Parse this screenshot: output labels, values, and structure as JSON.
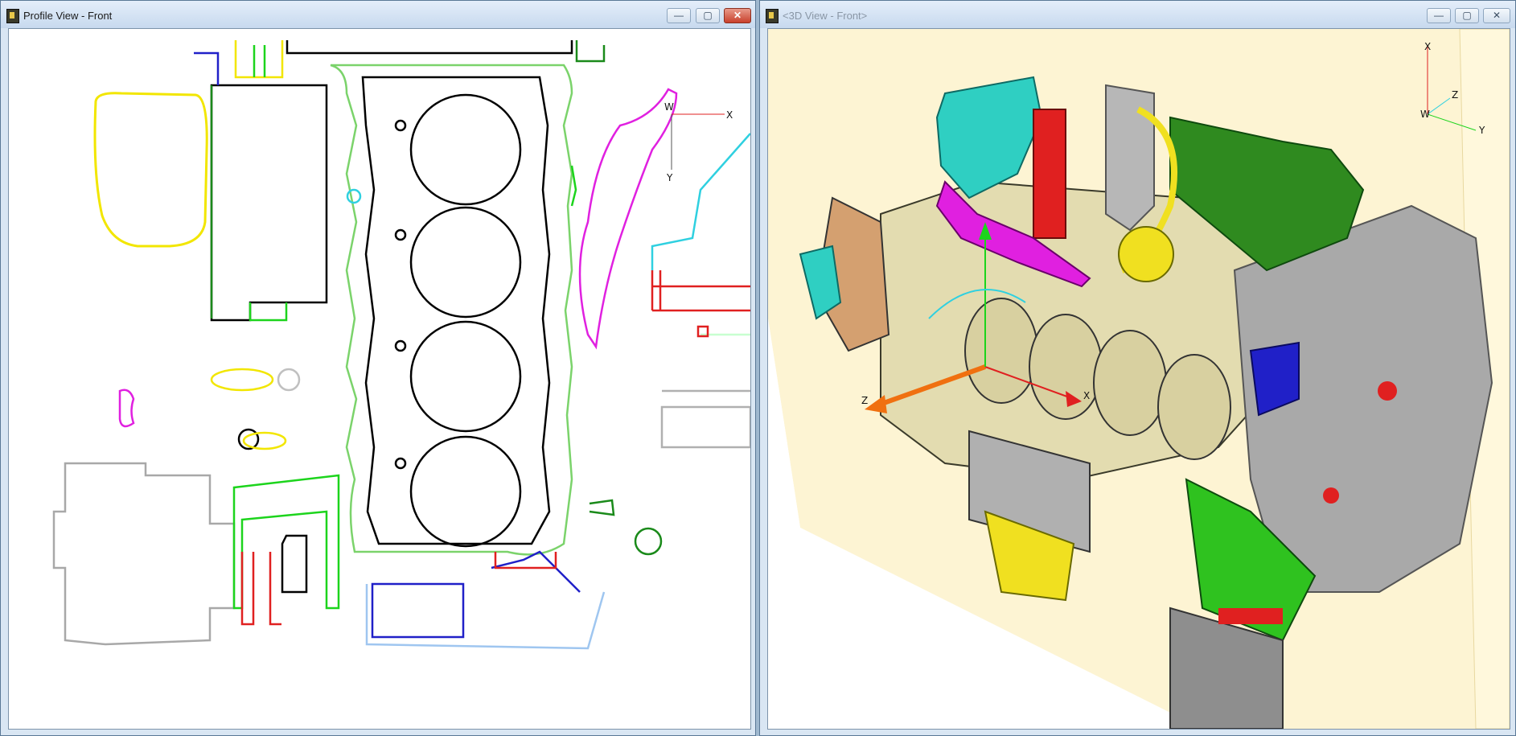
{
  "left_window": {
    "title": "Profile View - Front",
    "controls": {
      "minimize": "—",
      "maximize": "▢",
      "close": "✕"
    },
    "axis": {
      "x": "X",
      "y": "Y",
      "w": "W"
    }
  },
  "right_window": {
    "title": "<3D View - Front>",
    "controls": {
      "minimize": "—",
      "maximize": "▢",
      "close": "✕"
    },
    "axis": {
      "x": "X",
      "y": "Y",
      "z": "Z",
      "w": "W"
    },
    "manipulator": {
      "x": "X",
      "z": "Z"
    }
  },
  "colors": {
    "background_3d": "#fdf4d3",
    "block_cream": "#e3dcb0",
    "manifold_green": "#2f8a1f",
    "cover_gray": "#a9a9a9",
    "turbo_cyan": "#2fcfc2",
    "highlight_red": "#e02020",
    "highlight_magenta": "#e020e0",
    "highlight_yellow": "#f0e020",
    "highlight_blue": "#2020c8"
  }
}
